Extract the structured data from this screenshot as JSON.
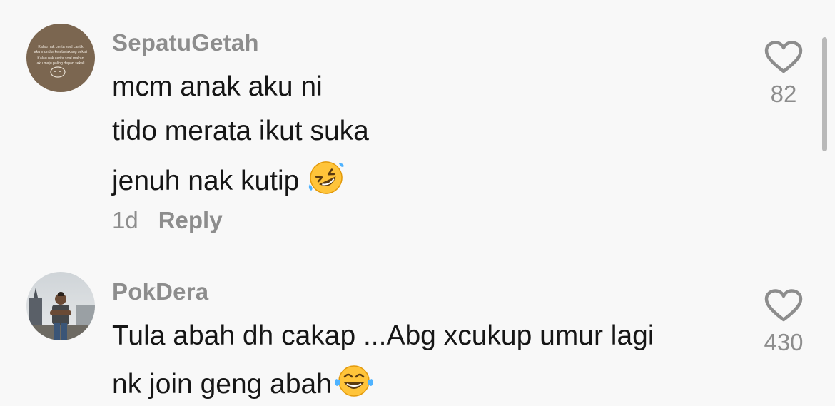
{
  "comments": [
    {
      "username": "SepatuGetah",
      "lines": [
        "mcm anak aku ni",
        "tido merata ikut suka",
        "jenuh nak kutip"
      ],
      "emoji": "rolling-on-floor-laughing",
      "time": "1d",
      "reply_label": "Reply",
      "like_count": "82",
      "avatar_text": [
        "Kalau nak cerita soal cantik",
        "aku mundur ketebelakang sekali",
        "Kalau nak cerita soal makan",
        "aku maju paling depan sekali"
      ]
    },
    {
      "username": "PokDera",
      "lines": [
        "Tula abah dh cakap ...Abg xcukup umur lagi",
        "nk join geng abah"
      ],
      "emoji": "face-with-tears-of-joy",
      "like_count": "430"
    }
  ],
  "icons": {
    "like": "heart-outline-icon"
  },
  "colors": {
    "background": "#f8f8f8",
    "username": "#8d8d8d",
    "text": "#161616",
    "emoji": "#ffc43a"
  }
}
